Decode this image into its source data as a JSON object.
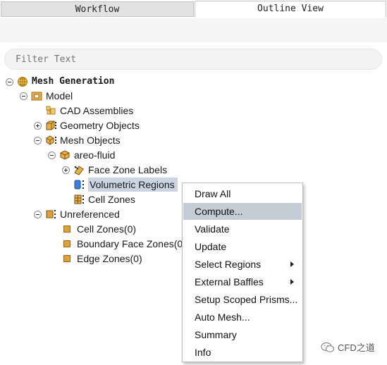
{
  "tabs": {
    "workflow": "Workflow",
    "outline": "Outline View"
  },
  "search": {
    "placeholder": "Filter Text"
  },
  "tree": {
    "mesh_generation": "Mesh Generation",
    "model": "Model",
    "cad_assemblies": "CAD Assemblies",
    "geometry_objects": "Geometry Objects",
    "mesh_objects": "Mesh Objects",
    "areo_fluid": "areo-fluid",
    "face_zone_labels": "Face Zone Labels",
    "volumetric_regions": "Volumetric Regions",
    "cell_zones": "Cell Zones",
    "unreferenced": "Unreferenced",
    "cell_zones_0": "Cell Zones(0)",
    "boundary_face_zones_0": "Boundary Face Zones(0)",
    "edge_zones_0": "Edge Zones(0)"
  },
  "context_menu": {
    "items": [
      {
        "label": "Draw All"
      },
      {
        "label": "Compute...",
        "highlighted": true
      },
      {
        "label": "Validate"
      },
      {
        "label": "Update"
      },
      {
        "label": "Select Regions",
        "submenu": true
      },
      {
        "label": "External Baffles",
        "submenu": true
      },
      {
        "label": "Setup Scoped Prisms..."
      },
      {
        "label": "Auto Mesh..."
      },
      {
        "label": "Summary"
      },
      {
        "label": "Info"
      }
    ]
  },
  "watermark": {
    "text": "CFD之道"
  },
  "colors": {
    "selection": "#cbd5e2",
    "menu_highlight": "#c4ccd6",
    "zone_square": "#dca13b",
    "folder": "#e8b04a"
  }
}
